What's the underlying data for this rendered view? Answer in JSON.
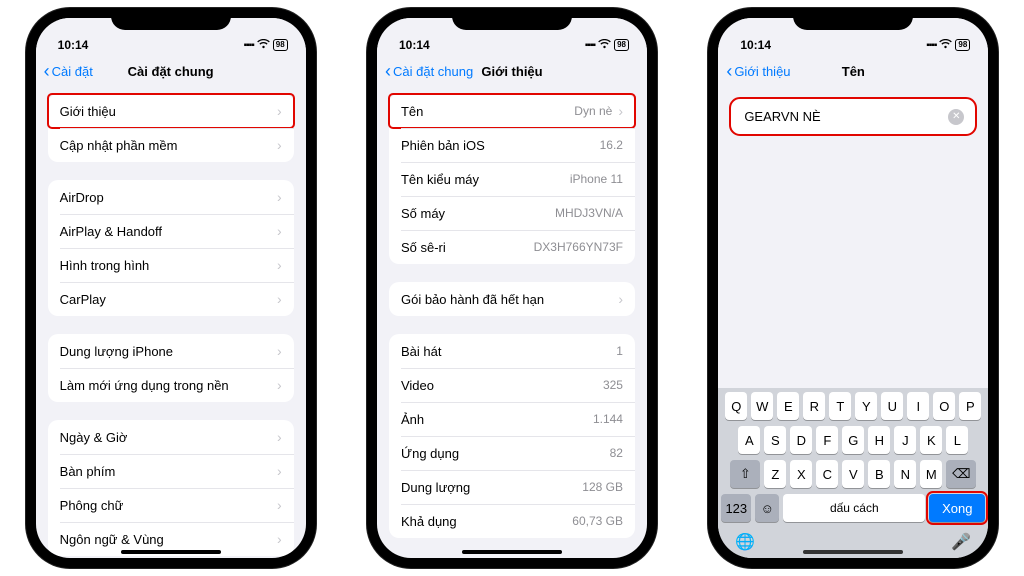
{
  "status": {
    "time": "10:14",
    "battery": "98"
  },
  "phone1": {
    "back": "Cài đặt",
    "title": "Cài đặt chung",
    "g1": [
      {
        "label": "Giới thiệu",
        "hl": true
      },
      {
        "label": "Cập nhật phần mềm"
      }
    ],
    "g2": [
      {
        "label": "AirDrop"
      },
      {
        "label": "AirPlay & Handoff"
      },
      {
        "label": "Hình trong hình"
      },
      {
        "label": "CarPlay"
      }
    ],
    "g3": [
      {
        "label": "Dung lượng iPhone"
      },
      {
        "label": "Làm mới ứng dụng trong nền"
      }
    ],
    "g4": [
      {
        "label": "Ngày & Giờ"
      },
      {
        "label": "Bàn phím"
      },
      {
        "label": "Phông chữ"
      },
      {
        "label": "Ngôn ngữ & Vùng"
      }
    ]
  },
  "phone2": {
    "back": "Cài đặt chung",
    "title": "Giới thiệu",
    "g1": [
      {
        "label": "Tên",
        "val": "Dyn nè",
        "chev": true,
        "hl": true
      },
      {
        "label": "Phiên bản iOS",
        "val": "16.2"
      },
      {
        "label": "Tên kiểu máy",
        "val": "iPhone 11"
      },
      {
        "label": "Số máy",
        "val": "MHDJ3VN/A"
      },
      {
        "label": "Số sê-ri",
        "val": "DX3H766YN73F"
      }
    ],
    "g2": [
      {
        "label": "Gói bảo hành đã hết hạn",
        "chev": true
      }
    ],
    "g3": [
      {
        "label": "Bài hát",
        "val": "1"
      },
      {
        "label": "Video",
        "val": "325"
      },
      {
        "label": "Ảnh",
        "val": "1.144"
      },
      {
        "label": "Ứng dụng",
        "val": "82"
      },
      {
        "label": "Dung lượng",
        "val": "128 GB"
      },
      {
        "label": "Khả dụng",
        "val": "60,73 GB"
      }
    ]
  },
  "phone3": {
    "back": "Giới thiệu",
    "title": "Tên",
    "value": "GEARVN NÈ",
    "keyboard": {
      "r1": [
        "Q",
        "W",
        "E",
        "R",
        "T",
        "Y",
        "U",
        "I",
        "O",
        "P"
      ],
      "r2": [
        "A",
        "S",
        "D",
        "F",
        "G",
        "H",
        "J",
        "K",
        "L"
      ],
      "r3": [
        "Z",
        "X",
        "C",
        "V",
        "B",
        "N",
        "M"
      ],
      "num": "123",
      "space": "dấu cách",
      "done": "Xong"
    }
  }
}
